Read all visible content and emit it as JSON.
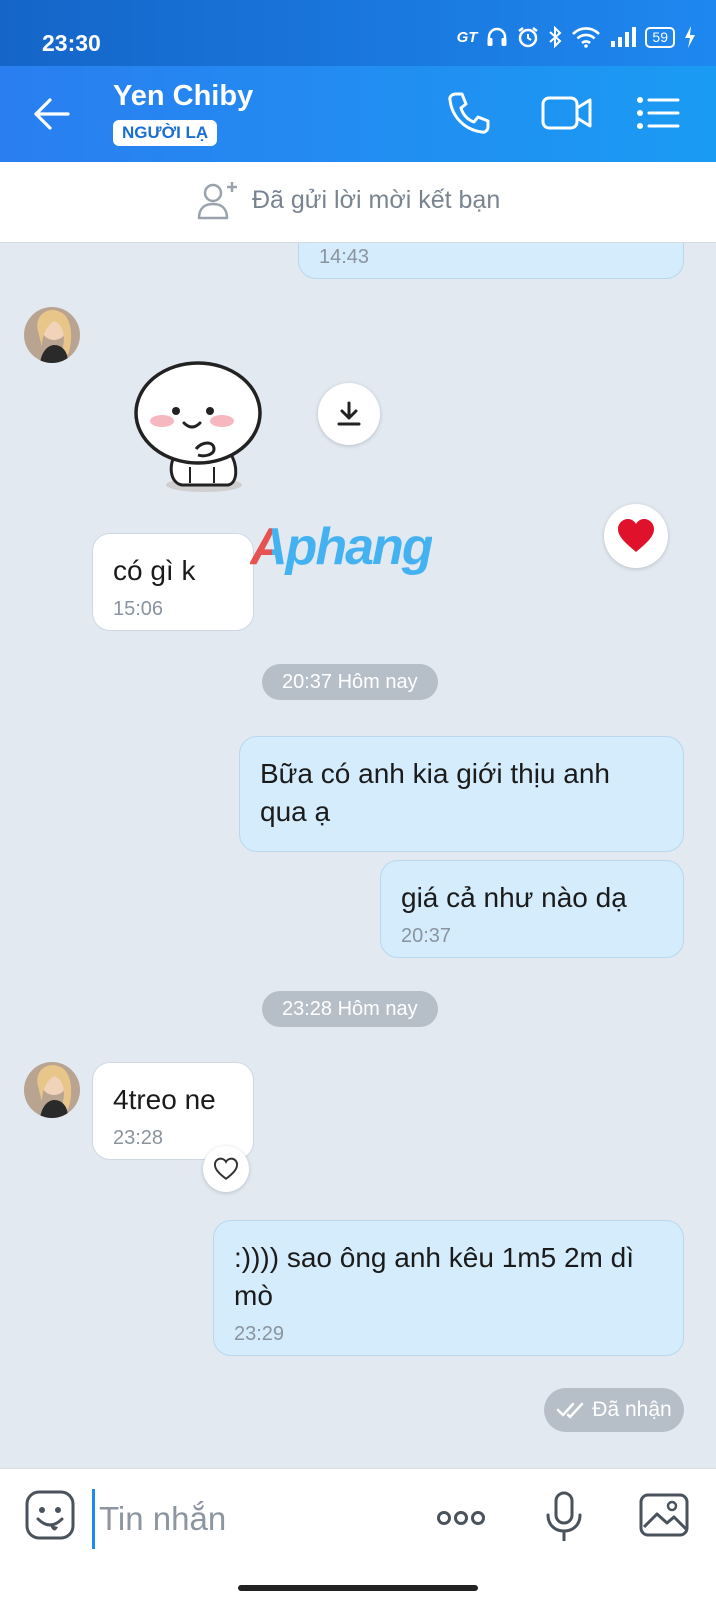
{
  "status_bar": {
    "time": "23:30",
    "network_label": "GT",
    "battery": "59",
    "icons": [
      "headphones-icon",
      "alarm-icon",
      "bluetooth-icon",
      "wifi-icon",
      "signal-icon",
      "battery-icon",
      "charging-icon"
    ]
  },
  "header": {
    "contact_name": "Yen Chiby",
    "badge": "NGƯỜI LẠ",
    "icons": [
      "back-arrow-icon",
      "phone-icon",
      "video-call-icon",
      "menu-list-icon"
    ]
  },
  "friend_bar": {
    "text": "Đã gửi lời mời kết bạn",
    "icon": "add-person-icon"
  },
  "messages": [
    {
      "side": "sent",
      "text": "",
      "time": "14:43"
    },
    {
      "side": "received",
      "type": "sticker",
      "sticker": "smiling-blob-sticker",
      "time": ""
    },
    {
      "side": "received",
      "text": "có gì k",
      "time": "15:06",
      "reaction": "heart"
    },
    {
      "side": "divider",
      "text": "20:37 Hôm nay"
    },
    {
      "side": "sent",
      "text": "Bữa có anh kia giới thịu anh qua ạ",
      "time": ""
    },
    {
      "side": "sent",
      "text": "giá cả như nào dạ",
      "time": "20:37"
    },
    {
      "side": "divider",
      "text": "23:28 Hôm nay"
    },
    {
      "side": "received",
      "text": "4treo ne",
      "time": "23:28"
    },
    {
      "side": "sent",
      "text": ":)))) sao ông anh kêu 1m5 2m dì mò",
      "time": "23:29"
    }
  ],
  "watermark": "Aphang",
  "status": {
    "received": "Đã nhận"
  },
  "composer": {
    "placeholder": "Tin nhắn",
    "icons": [
      "emoji-icon",
      "more-icon",
      "microphone-icon",
      "image-icon"
    ]
  },
  "colors": {
    "header": "#1e88f0",
    "chat_background": "#e2e9f1",
    "sent_bubble": "#d4ecfc",
    "received_bubble": "#ffffff",
    "heart": "#e0112b"
  }
}
